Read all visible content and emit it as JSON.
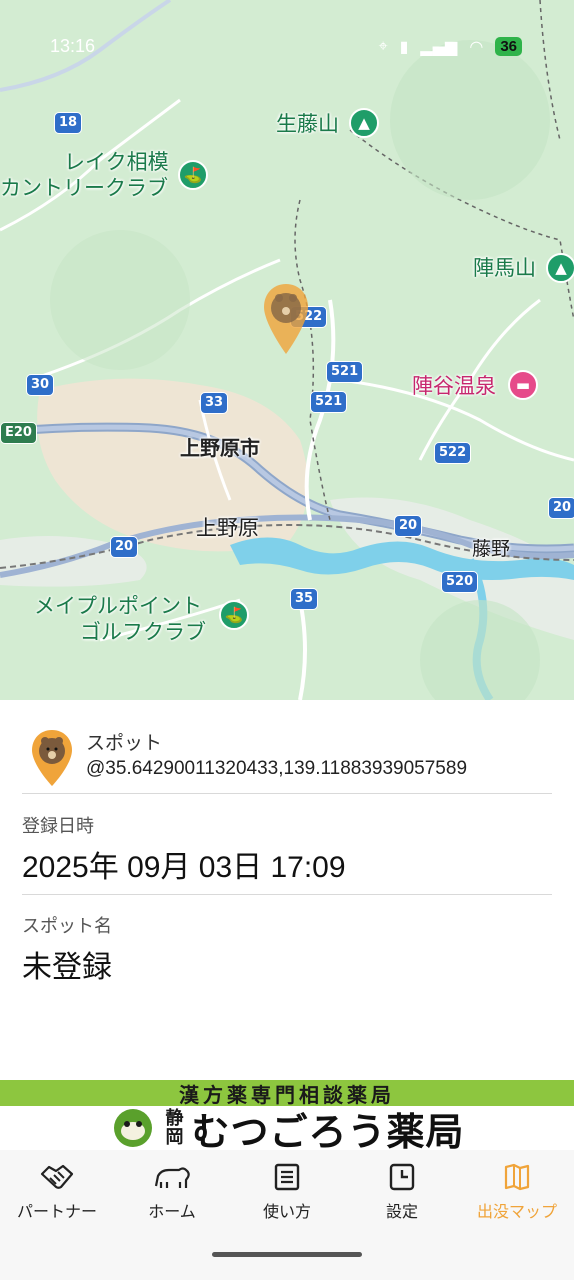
{
  "status_bar": {
    "time": "13:16",
    "battery": "36"
  },
  "map": {
    "labels": {
      "ikouyama": "生藤山",
      "lake_country_1": "レイク相模",
      "lake_country_2": "カントリークラブ",
      "jinba": "陣馬山",
      "jinya_onsen": "陣谷温泉",
      "uenohara_city": "上野原市",
      "uenohara_station": "上野原",
      "fujino": "藤野",
      "maple_1": "メイプルポイント",
      "maple_2": "ゴルフクラブ"
    },
    "routes": {
      "r18": "18",
      "r30": "30",
      "r33": "33",
      "r35": "35",
      "e20": "E20",
      "r20a": "20",
      "r20b": "20",
      "r20c": "20",
      "r520": "520",
      "r521a": "521",
      "r521b": "521",
      "r522a": "522",
      "r522b": "522"
    },
    "colors": {
      "land": "#d3ecd2",
      "urban": "#f1e4d4",
      "river": "#7fd0ea",
      "highway": "#8ea6c9",
      "marker": "#f0a43a"
    }
  },
  "spot": {
    "label": "スポット",
    "coordinates": "@35.64290011320433,139.11883939057589"
  },
  "registered": {
    "caption": "登録日時",
    "value": "2025年 09月 03日 17:09"
  },
  "spot_name": {
    "caption": "スポット名",
    "value": "未登録"
  },
  "banner": {
    "tagline": "漢方薬専門相談薬局",
    "region_1": "静",
    "region_2": "岡",
    "name": "むつごろう薬局"
  },
  "nav": {
    "items": [
      {
        "label": "パートナー",
        "icon": "handshake-icon"
      },
      {
        "label": "ホーム",
        "icon": "bear-icon"
      },
      {
        "label": "使い方",
        "icon": "document-icon"
      },
      {
        "label": "設定",
        "icon": "clock-icon"
      },
      {
        "label": "出没マップ",
        "icon": "map-icon"
      }
    ],
    "active_index": 4,
    "active_color": "#f0a43a"
  }
}
